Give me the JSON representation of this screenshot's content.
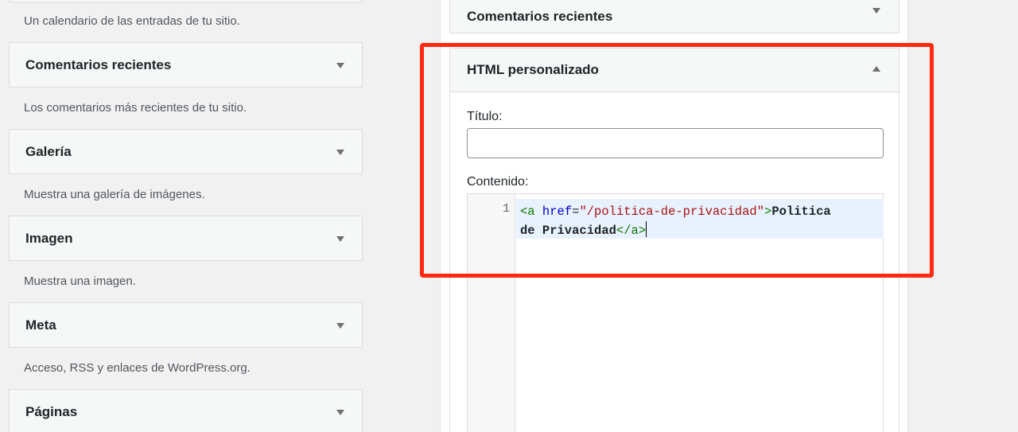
{
  "available_widgets": {
    "first_description": "Un calendario de las entradas de tu sitio.",
    "items": [
      {
        "title": "Comentarios recientes",
        "description": "Los comentarios más recientes de tu sitio."
      },
      {
        "title": "Galería",
        "description": "Muestra una galería de imágenes."
      },
      {
        "title": "Imagen",
        "description": "Muestra una imagen."
      },
      {
        "title": "Meta",
        "description": "Acceso, RSS y enlaces de WordPress.org."
      },
      {
        "title": "Páginas",
        "description": ""
      }
    ]
  },
  "sidebar": {
    "collapsed_widget_title": "Comentarios recientes",
    "html_widget": {
      "title": "HTML personalizado",
      "title_label": "Título:",
      "title_value": "",
      "content_label": "Contenido:",
      "editor": {
        "line_number": "1",
        "tag_open": "<a",
        "attr_name": "href",
        "equals": "=",
        "attr_value": "\"/politica-de-privacidad\"",
        "tag_open_close": ">",
        "text_line1": "Politica",
        "text_line2": "de Privacidad",
        "tag_close": "</a>"
      }
    }
  },
  "colors": {
    "highlight": "#ff2a12",
    "active_line": "#e8f2fe",
    "tag": "#117700",
    "attribute": "#0000cc",
    "string": "#aa1111"
  },
  "icons": {
    "collapse": "arrow-down-icon",
    "expand": "arrow-up-icon"
  }
}
